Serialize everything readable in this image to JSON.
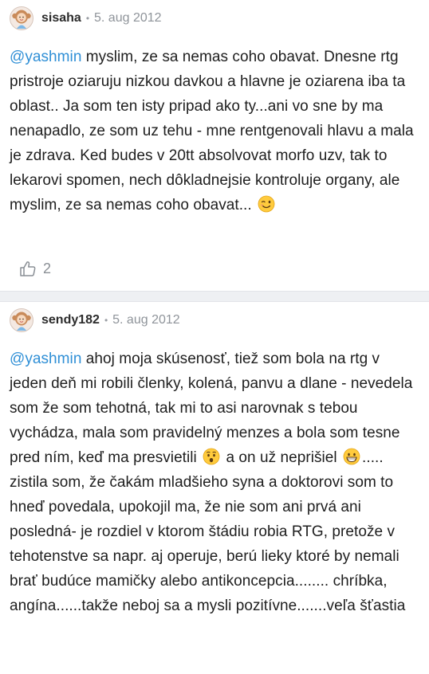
{
  "posts": [
    {
      "author": "sisaha",
      "separator": "•",
      "date": "5. aug 2012",
      "mention": "@yashmin",
      "text": " myslim, ze sa nemas coho obavat. Dnesne rtg pristroje oziaruju nizkou davkou a hlavne je oziarena iba ta oblast.. Ja som ten isty pripad ako ty...ani vo sne by ma nenapadlo, ze som uz tehu - mne rentgenovali hlavu a mala je zdrava. Ked budes v 20tt absolvovat morfo uzv, tak to lekarovi spomen, nech dôkladnejsie kontroluje organy, ale myslim, ze sa nemas coho obavat... ",
      "emoji": "wink-emoji-icon",
      "likes": "2"
    },
    {
      "author": "sendy182",
      "separator": "•",
      "date": "5. aug 2012",
      "mention": "@yashmin",
      "text_part1": " ahoj moja skúsenosť, tiež som bola na rtg v jeden deň mi robili členky, kolená, panvu a dlane - nevedela som že som tehotná, tak mi to asi narovnak s tebou vychádza, mala som pravidelný menzes a bola som tesne pred ním, keď ma presvietili ",
      "emoji1": "surprised-emoji-icon",
      "text_part2": " a on už neprišiel ",
      "emoji2": "grin-emoji-icon",
      "text_part3": "..... zistila som, že čakám mladšieho syna a doktorovi som to hneď povedala, upokojil ma, že nie som ani prvá ani posledná- je rozdiel v ktorom štádiu robia RTG, pretože v tehotenstve sa napr. aj operuje, berú lieky ktoré by nemali brať budúce mamičky alebo antikoncepcia........ chríbka, angína......takže neboj sa a mysli pozitívne.......veľa šťastia"
    }
  ],
  "colors": {
    "mention": "#2f8fd6",
    "divider": "#eef0f3",
    "meta": "#8f949a"
  }
}
